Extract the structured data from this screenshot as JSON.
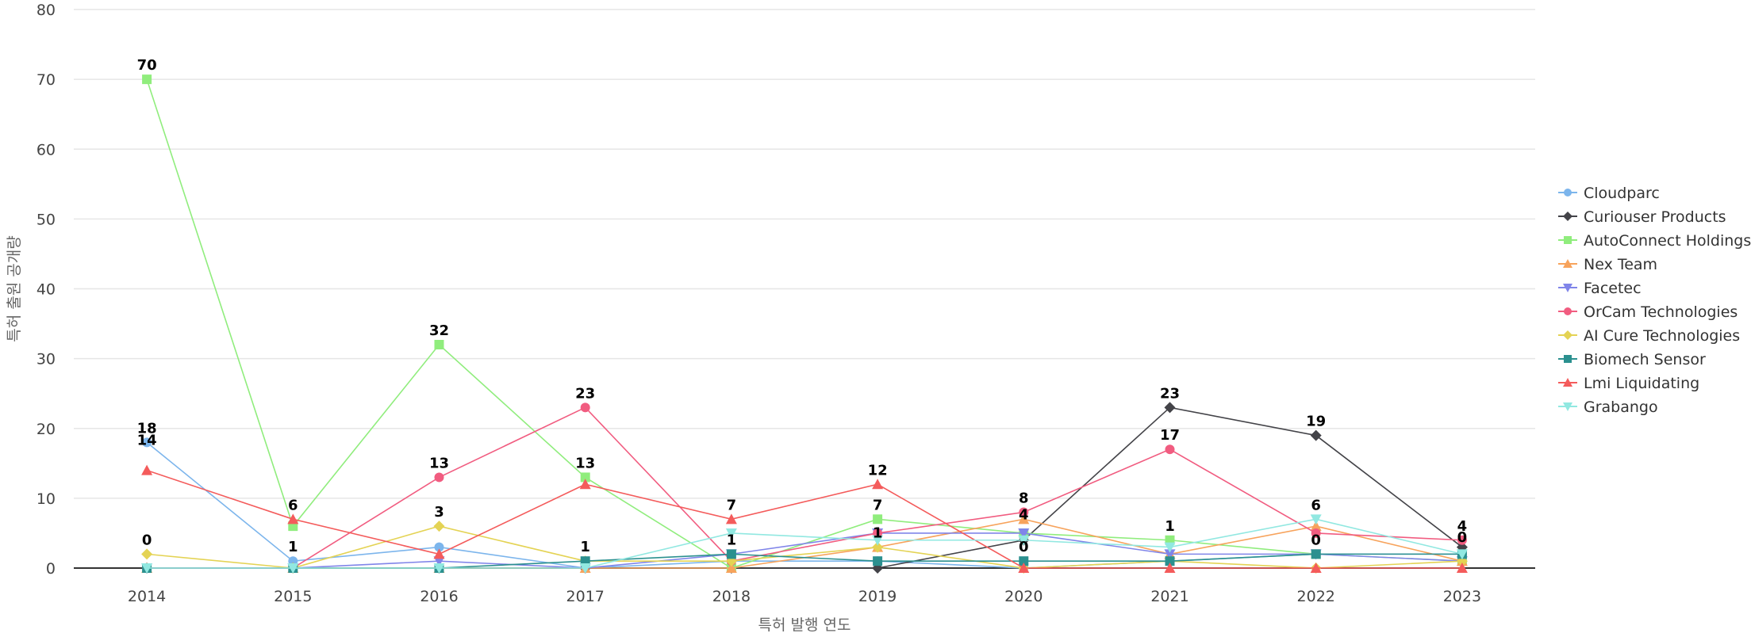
{
  "chart_data": {
    "type": "line",
    "title": "",
    "xlabel": "특허 발행 연도",
    "ylabel": "특허 출원 공개량",
    "x": [
      "2014",
      "2015",
      "2016",
      "2017",
      "2018",
      "2019",
      "2020",
      "2021",
      "2022",
      "2023"
    ],
    "ylim": [
      0,
      80
    ],
    "yticks": [
      0,
      10,
      20,
      30,
      40,
      50,
      60,
      70,
      80
    ],
    "grid": true,
    "legend_position": "right",
    "series": [
      {
        "name": "Cloudparc",
        "color": "#7cb5ec",
        "marker": "circle",
        "values": [
          18,
          1,
          3,
          0,
          1,
          1,
          0,
          1,
          2,
          2
        ]
      },
      {
        "name": "Curiouser Products",
        "color": "#434348",
        "marker": "diamond",
        "values": [
          0,
          0,
          0,
          0,
          0,
          0,
          4,
          23,
          19,
          3
        ]
      },
      {
        "name": "AutoConnect Holdings",
        "color": "#90ed7d",
        "marker": "square",
        "values": [
          70,
          6,
          32,
          13,
          0,
          7,
          5,
          4,
          2,
          1
        ]
      },
      {
        "name": "Nex Team",
        "color": "#f7a35c",
        "marker": "triangle",
        "values": [
          0,
          0,
          0,
          0,
          0,
          3,
          7,
          2,
          6,
          1
        ]
      },
      {
        "name": "Facetec",
        "color": "#8085e9",
        "marker": "triangle-down",
        "values": [
          0,
          0,
          1,
          0,
          2,
          5,
          5,
          2,
          2,
          1
        ]
      },
      {
        "name": "OrCam Technologies",
        "color": "#f15c80",
        "marker": "circle",
        "values": [
          0,
          0,
          13,
          23,
          1,
          5,
          8,
          17,
          5,
          4
        ]
      },
      {
        "name": "AI Cure Technologies",
        "color": "#e4d354",
        "marker": "diamond",
        "values": [
          2,
          0,
          6,
          1,
          1,
          3,
          0,
          1,
          0,
          1
        ]
      },
      {
        "name": "Biomech Sensor",
        "color": "#2b908f",
        "marker": "square",
        "values": [
          0,
          0,
          0,
          1,
          2,
          1,
          1,
          1,
          2,
          2
        ]
      },
      {
        "name": "Lmi Liquidating",
        "color": "#f45b5b",
        "marker": "triangle",
        "values": [
          14,
          7,
          2,
          12,
          7,
          12,
          0,
          0,
          0,
          0
        ]
      },
      {
        "name": "Grabango",
        "color": "#91e8e1",
        "marker": "triangle-down",
        "values": [
          0,
          0,
          0,
          0,
          5,
          4,
          4,
          3,
          7,
          2
        ]
      }
    ],
    "data_labels": [
      {
        "x": "2014",
        "text": "70",
        "value": 70
      },
      {
        "x": "2014",
        "text": "18",
        "value": 18
      },
      {
        "x": "2014",
        "text": "14",
        "value": 16.3
      },
      {
        "x": "2014",
        "text": "0",
        "value": 2
      },
      {
        "x": "2015",
        "text": "6",
        "value": 7
      },
      {
        "x": "2015",
        "text": "1",
        "value": 1
      },
      {
        "x": "2016",
        "text": "32",
        "value": 32
      },
      {
        "x": "2016",
        "text": "13",
        "value": 13
      },
      {
        "x": "2016",
        "text": "3",
        "value": 6
      },
      {
        "x": "2017",
        "text": "23",
        "value": 23
      },
      {
        "x": "2017",
        "text": "13",
        "value": 13
      },
      {
        "x": "2017",
        "text": "1",
        "value": 1
      },
      {
        "x": "2018",
        "text": "7",
        "value": 7
      },
      {
        "x": "2018",
        "text": "1",
        "value": 2
      },
      {
        "x": "2019",
        "text": "12",
        "value": 12
      },
      {
        "x": "2019",
        "text": "7",
        "value": 7
      },
      {
        "x": "2019",
        "text": "1",
        "value": 3
      },
      {
        "x": "2020",
        "text": "8",
        "value": 8
      },
      {
        "x": "2020",
        "text": "4",
        "value": 5.6
      },
      {
        "x": "2020",
        "text": "0",
        "value": 1
      },
      {
        "x": "2021",
        "text": "23",
        "value": 23
      },
      {
        "x": "2021",
        "text": "17",
        "value": 17
      },
      {
        "x": "2021",
        "text": "1",
        "value": 4
      },
      {
        "x": "2022",
        "text": "19",
        "value": 19
      },
      {
        "x": "2022",
        "text": "6",
        "value": 7
      },
      {
        "x": "2022",
        "text": "0",
        "value": 2
      },
      {
        "x": "2023",
        "text": "4",
        "value": 4
      },
      {
        "x": "2023",
        "text": "0",
        "value": 2.4
      }
    ]
  }
}
